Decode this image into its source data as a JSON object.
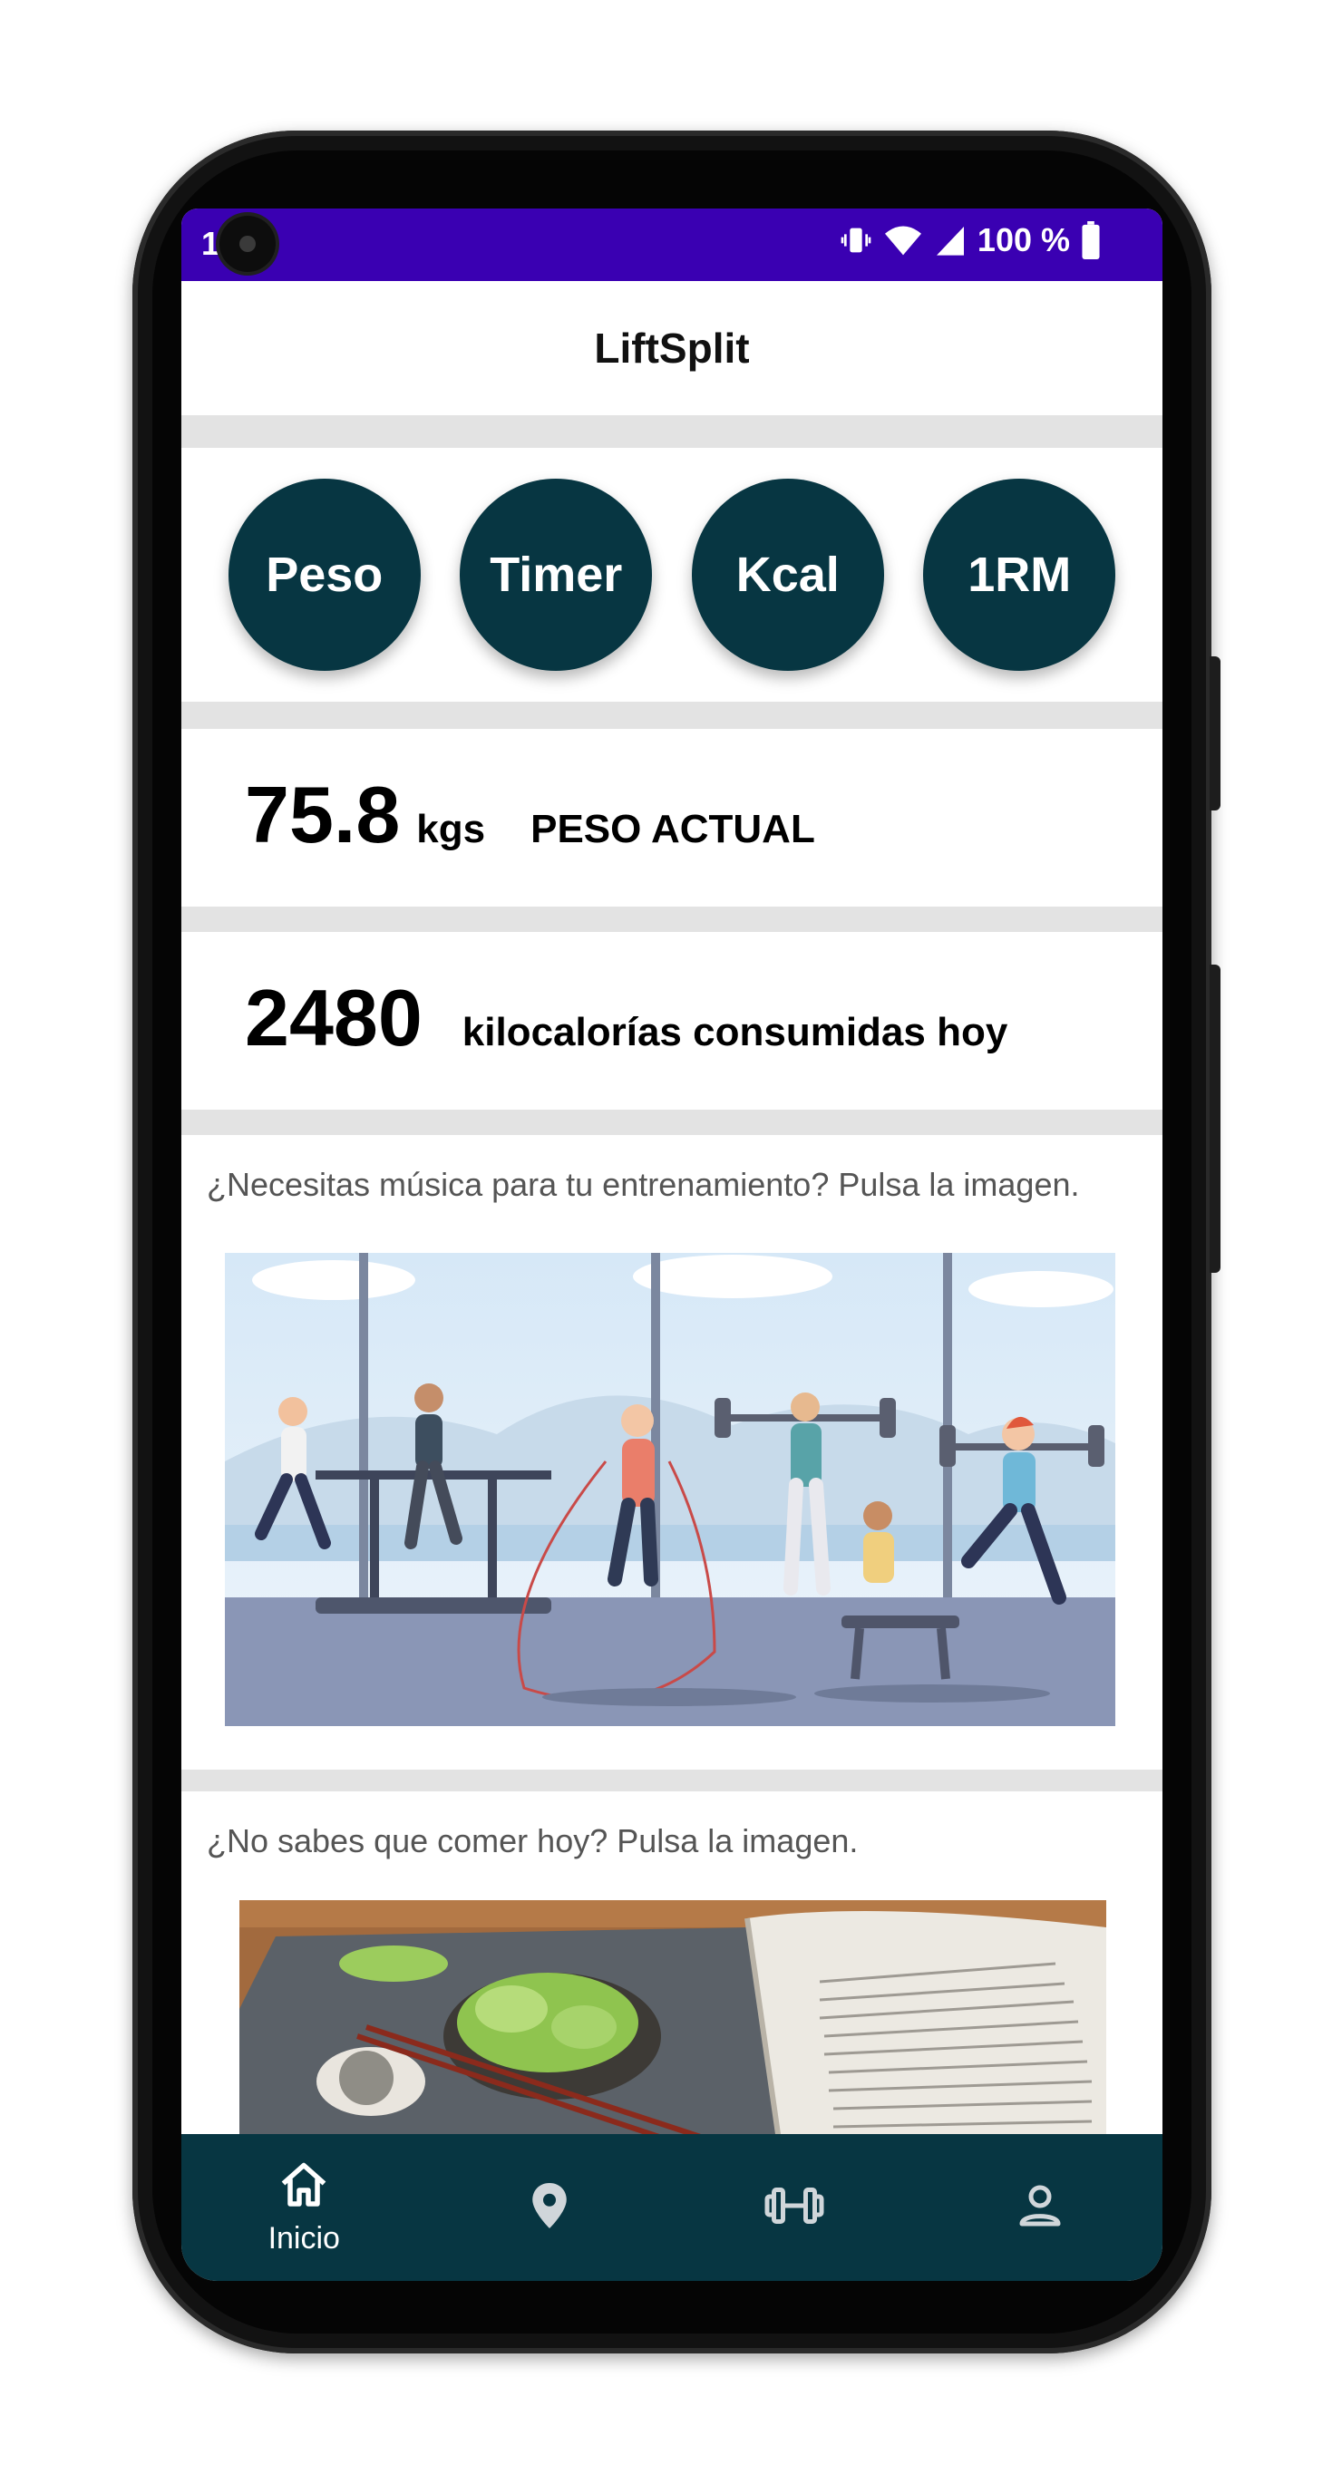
{
  "status_bar": {
    "time": "1",
    "battery_text": "100 %",
    "vibrate_icon": "vibrate-icon",
    "wifi_icon": "wifi-icon",
    "signal_icon": "signal-icon",
    "battery_icon": "battery-icon",
    "color": "#3a00b2"
  },
  "app_bar": {
    "title": "LiftSplit"
  },
  "quick_actions": [
    {
      "label": "Peso"
    },
    {
      "label": "Timer"
    },
    {
      "label": "Kcal"
    },
    {
      "label": "1RM"
    }
  ],
  "weight": {
    "value": "75.8",
    "unit": "kgs",
    "label": "PESO ACTUAL"
  },
  "calories": {
    "value": "2480",
    "label": "kilocalorías consumidas hoy"
  },
  "music": {
    "prompt": "¿Necesitas música para tu entrenamiento? Pulsa la imagen."
  },
  "food": {
    "prompt": "¿No sabes que comer hoy? Pulsa la imagen."
  },
  "bottom_nav": [
    {
      "icon": "home-icon",
      "label": "Inicio"
    },
    {
      "icon": "location-pin-icon",
      "label": ""
    },
    {
      "icon": "dumbbell-icon",
      "label": ""
    },
    {
      "icon": "person-icon",
      "label": ""
    }
  ],
  "colors": {
    "primary": "#073642",
    "status": "#3a00b2"
  }
}
